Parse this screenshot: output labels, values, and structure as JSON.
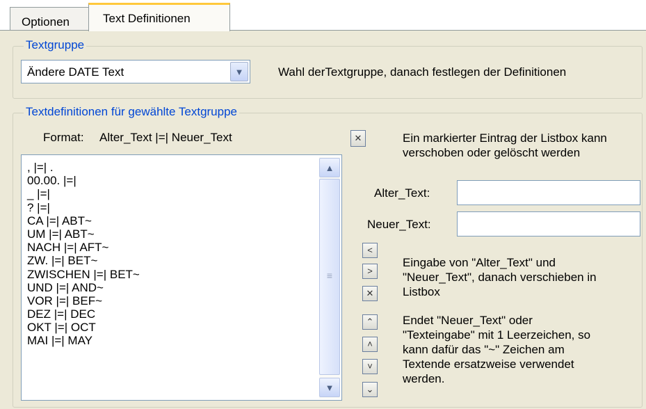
{
  "tabs": [
    "Optionen",
    "Text Definitionen"
  ],
  "textgruppe": {
    "legend": "Textgruppe",
    "combo_value": "Ändere DATE Text",
    "hint": "Wahl derTextgruppe, danach festlegen der Definitionen"
  },
  "defs": {
    "legend": "Textdefinitionen für gewählte Textgruppe",
    "format_label": "Format:",
    "format_value": "Alter_Text |=| Neuer_Text",
    "items": [
      ", |=| .",
      "00.00. |=|",
      "_ |=|",
      "? |=|",
      "CA |=| ABT~",
      "UM |=| ABT~",
      "NACH |=| AFT~",
      "ZW. |=| BET~",
      "ZWISCHEN |=| BET~",
      "UND |=| AND~",
      "VOR |=| BEF~",
      "DEZ |=| DEC",
      "OKT |=| OCT",
      "MAI |=| MAY"
    ],
    "delete_hint_line1": "Ein markierter Eintrag der Listbox kann",
    "delete_hint_line2": "verschoben oder gelöscht werden",
    "alter_label": "Alter_Text:",
    "alter_value": "",
    "neuer_label": "Neuer_Text:",
    "neuer_value": "",
    "move_hint_line1": "Eingabe von \"Alter_Text\" und",
    "move_hint_line2": "\"Neuer_Text\", danach verschieben in",
    "move_hint_line3": "Listbox",
    "tilde_hint_line1": "Endet \"Neuer_Text\" oder",
    "tilde_hint_line2": "\"Texteingabe\" mit 1 Leerzeichen, so",
    "tilde_hint_line3": "kann dafür das \"~\" Zeichen am",
    "tilde_hint_line4": "Textende ersatzweise verwendet",
    "tilde_hint_line5": "werden."
  },
  "icons": {
    "combo_arrow": "chevron-down-icon",
    "delete": "x-icon",
    "move_left": "chevron-left-icon",
    "move_right": "chevron-right-icon",
    "remove": "x-icon",
    "move_top": "double-chevron-up-icon",
    "move_up": "chevron-up-icon",
    "move_down": "chevron-down-icon",
    "move_bottom": "double-chevron-down-icon"
  },
  "colors": {
    "legend_text": "#0046d5",
    "active_tab_accent": "#ffc83c",
    "dialog_bg": "#ece9d8"
  }
}
